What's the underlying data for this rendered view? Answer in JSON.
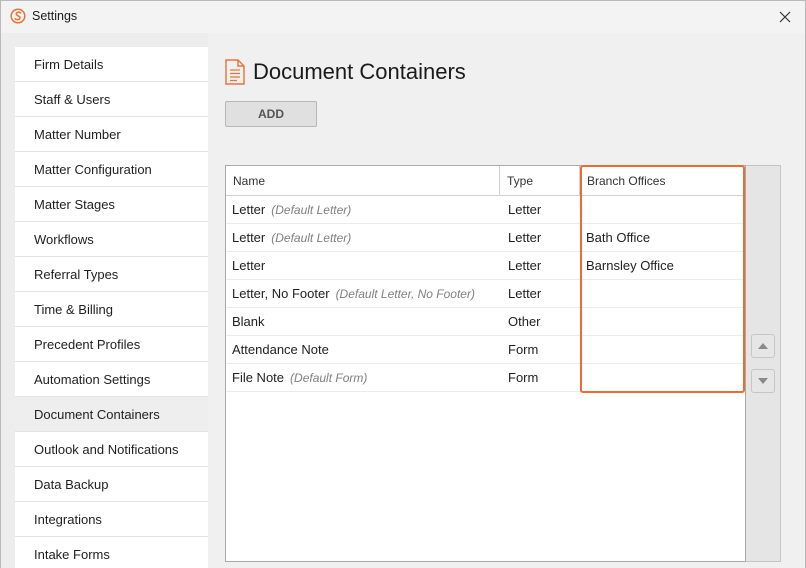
{
  "window": {
    "title": "Settings"
  },
  "sidebar": {
    "items": [
      {
        "label": "Firm Details"
      },
      {
        "label": "Staff & Users"
      },
      {
        "label": "Matter Number"
      },
      {
        "label": "Matter Configuration"
      },
      {
        "label": "Matter Stages"
      },
      {
        "label": "Workflows"
      },
      {
        "label": "Referral Types"
      },
      {
        "label": "Time & Billing"
      },
      {
        "label": "Precedent Profiles"
      },
      {
        "label": "Automation Settings"
      },
      {
        "label": "Document Containers"
      },
      {
        "label": "Outlook and Notifications"
      },
      {
        "label": "Data Backup"
      },
      {
        "label": "Integrations"
      },
      {
        "label": "Intake Forms"
      }
    ],
    "active_index": 10
  },
  "main": {
    "title": "Document Containers",
    "add_label": "ADD",
    "table": {
      "columns": {
        "name": "Name",
        "type": "Type",
        "branch": "Branch Offices"
      },
      "rows": [
        {
          "name": "Letter",
          "note": "(Default Letter)",
          "type": "Letter",
          "branch": ""
        },
        {
          "name": "Letter",
          "note": "(Default Letter)",
          "type": "Letter",
          "branch": "Bath Office"
        },
        {
          "name": "Letter",
          "note": "",
          "type": "Letter",
          "branch": "Barnsley Office"
        },
        {
          "name": "Letter, No Footer",
          "note": "(Default Letter, No Footer)",
          "type": "Letter",
          "branch": ""
        },
        {
          "name": "Blank",
          "note": "",
          "type": "Other",
          "branch": ""
        },
        {
          "name": "Attendance Note",
          "note": "",
          "type": "Form",
          "branch": ""
        },
        {
          "name": "File Note",
          "note": "(Default Form)",
          "type": "Form",
          "branch": ""
        }
      ]
    }
  },
  "colors": {
    "accent": "#ef6a2e",
    "icon": "#e8733a"
  }
}
